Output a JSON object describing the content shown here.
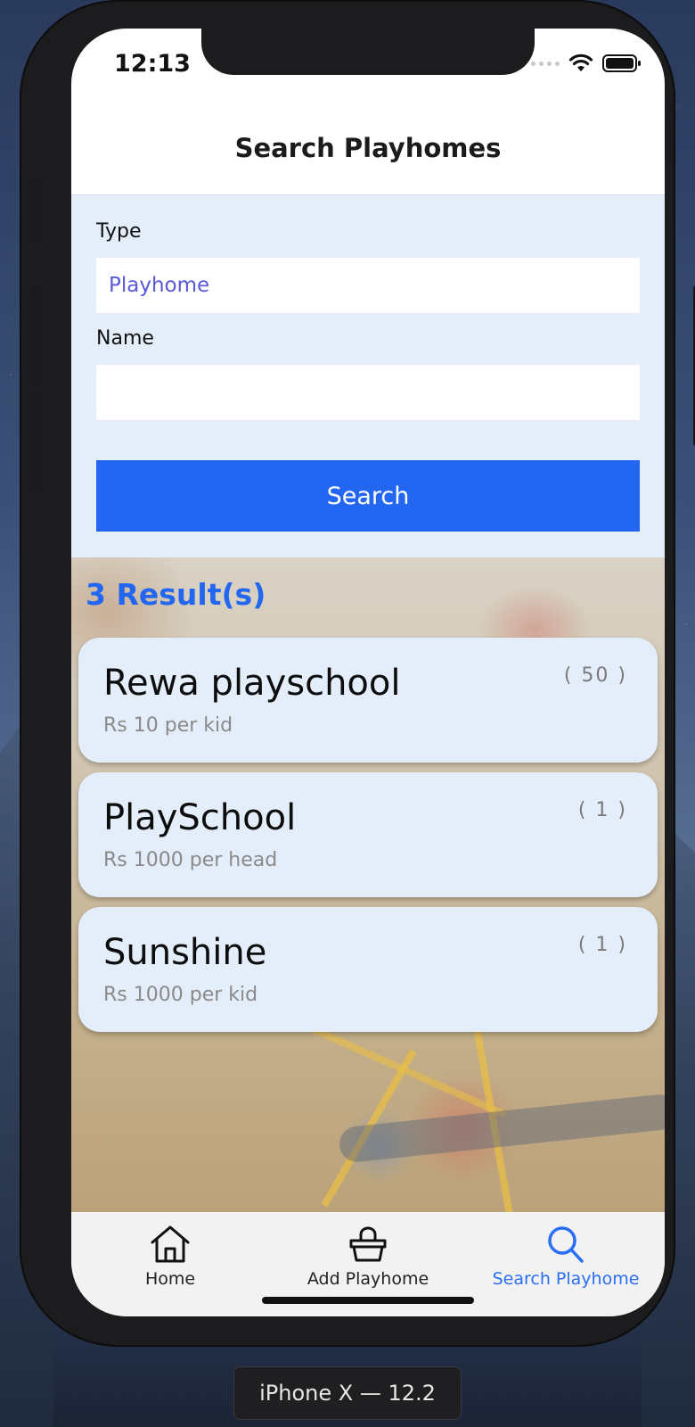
{
  "status_bar": {
    "time": "12:13"
  },
  "header": {
    "title": "Search Playhomes"
  },
  "form": {
    "type_label": "Type",
    "type_value": "Playhome",
    "name_label": "Name",
    "name_value": "",
    "search_button": "Search"
  },
  "results": {
    "count_label": "3 Result(s)",
    "items": [
      {
        "name": "Rewa playschool",
        "price": "Rs 10 per kid",
        "count": "( 50 )"
      },
      {
        "name": "PlaySchool",
        "price": "Rs 1000 per head",
        "count": "( 1 )"
      },
      {
        "name": "Sunshine",
        "price": "Rs 1000 per kid",
        "count": "( 1 )"
      }
    ]
  },
  "tab_bar": {
    "tabs": [
      {
        "label": "Home",
        "icon": "home-icon",
        "active": false
      },
      {
        "label": "Add Playhome",
        "icon": "basket-icon",
        "active": false
      },
      {
        "label": "Search Playhome",
        "icon": "search-icon",
        "active": true
      }
    ]
  },
  "simulator": {
    "device_label": "iPhone X — 12.2"
  },
  "colors": {
    "accent": "#2366f1",
    "form_background": "#e4eefb",
    "input_text": "#5a59d6"
  }
}
